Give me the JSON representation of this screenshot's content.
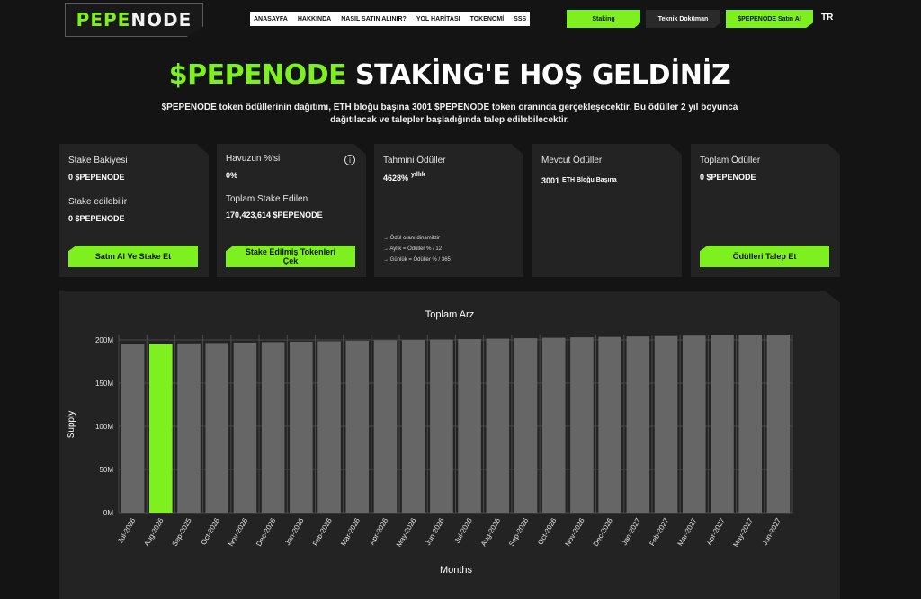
{
  "header": {
    "logo": {
      "part1": "PEPE",
      "part2": "NODE"
    },
    "nav": [
      "ANASAYFA",
      "HAKKINDA",
      "NASIL SATIN ALINIR?",
      "YOL HARİTASI",
      "TOKENOMİ",
      "SSS"
    ],
    "staking_button": "Staking",
    "docs_button": "Teknik Doküman",
    "buy_button": "$PEPENODE Satın Al",
    "language": "TR"
  },
  "hero": {
    "title_green": "$PEPENODE",
    "title_white": "STAKİNG'E HOŞ GELDİNİZ",
    "subtitle": "$PEPENODE token ödüllerinin dağıtımı, ETH bloğu başına 3001 $PEPENODE token oranında gerçekleşecektir. Bu ödüller 2 yıl boyunca dağıtılacak ve talepler başladığında talep edilebilecektir."
  },
  "cards": {
    "balance": {
      "label1": "Stake Bakiyesi",
      "value1": "0 $PEPENODE",
      "label2": "Stake edilebilir",
      "value2": "0 $PEPENODE",
      "button": "Satın Al Ve Stake Et"
    },
    "pool": {
      "label1": "Havuzun %'si",
      "value1": "0%",
      "label2": "Toplam Stake Edilen",
      "value2": "170,423,614 $PEPENODE",
      "button_line1": "Stake Edilmiş Tokenleri",
      "button_line2": "Çek",
      "info_icon": "i"
    },
    "estimated": {
      "label": "Tahmini Ödüller",
      "value": "4628%",
      "unit": "yıllık",
      "note1": "→ Ödül oranı dinamiktir",
      "note2": "→ Aylık = Ödüller % / 12",
      "note3": "→ Günlük = Ödüller % / 365"
    },
    "current": {
      "label": "Mevcut Ödüller",
      "value": "3001",
      "unit": "ETH Bloğu Başına"
    },
    "total": {
      "label": "Toplam Ödüller",
      "value": "0 $PEPENODE",
      "button": "Ödülleri Talep Et"
    }
  },
  "colors": {
    "accent": "#7ef01f",
    "bar": "#666666",
    "bar_highlight": "#7ef01f",
    "card": "#232323",
    "background": "#141414"
  },
  "chart_data": {
    "type": "bar",
    "title": "Toplam Arz",
    "xlabel": "Months",
    "ylabel": "Supply",
    "categories": [
      "Jul-2026",
      "Aug-2026",
      "Sep-2025",
      "Oct-2026",
      "Nov-2026",
      "Dec-2026",
      "Jan-2026",
      "Feb-2026",
      "Mar-2026",
      "Apr-2026",
      "May-2026",
      "Jun-2026",
      "Jul-2026",
      "Aug-2026",
      "Sep-2026",
      "Oct-2026",
      "Nov-2026",
      "Dec-2026",
      "Jan-2027",
      "Feb-2027",
      "Mar-2027",
      "Apr-2027",
      "May-2027",
      "Jun-2027"
    ],
    "values": [
      195,
      195,
      196,
      196.5,
      197,
      197.5,
      198,
      198.5,
      199,
      199.5,
      200,
      200.5,
      201,
      201.5,
      202,
      202.5,
      203,
      203.5,
      204,
      204.5,
      205,
      205.5,
      206,
      207
    ],
    "highlight_index": 1,
    "ylim": [
      0,
      200
    ],
    "yticks": [
      "0M",
      "50M",
      "100M",
      "150M",
      "200M"
    ],
    "grid": true
  }
}
